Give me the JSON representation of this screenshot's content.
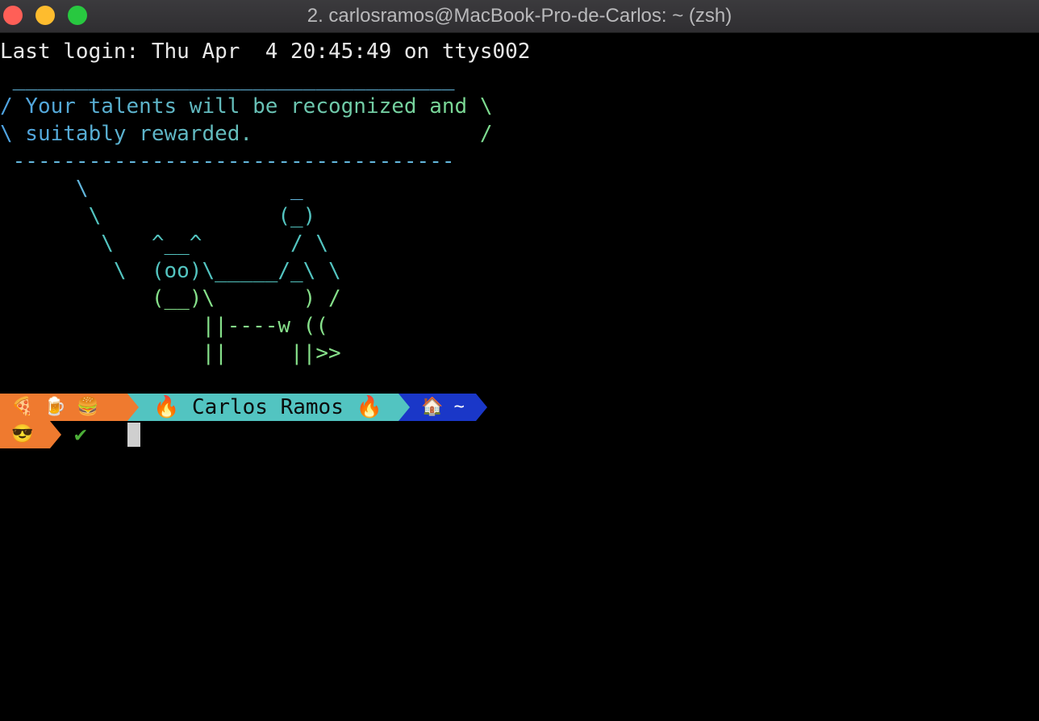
{
  "window": {
    "title": "2. carlosramos@MacBook-Pro-de-Carlos: ~ (zsh)"
  },
  "terminal": {
    "last_login": "Last login: Thu Apr  4 20:45:49 on ttys002",
    "cowsay": {
      "bubble_top": " ___________________________________",
      "line1": "/ Your talents will be recognized and \\",
      "line2": "\\ suitably rewarded.                  /",
      "bubble_bottom": " -----------------------------------",
      "cow": [
        "      \\                _",
        "       \\              (_)",
        "        \\   ^__^       / \\",
        "         \\  (oo)\\_____/_\\ \\",
        "            (__)\\       ) /",
        "                ||----w ((",
        "                ||     ||>>"
      ]
    },
    "prompt": {
      "emoji_segment": "🍕 🍺 🍔",
      "user_segment": "🔥 Carlos Ramos 🔥",
      "dir_segment": "🏠 ~",
      "second_line_emoji": "😎",
      "status_icon": "✔"
    }
  },
  "colors": {
    "orange": "#ef7a2f",
    "teal": "#52c4c1",
    "blue": "#1a37c8",
    "green_check": "#4caf38"
  }
}
